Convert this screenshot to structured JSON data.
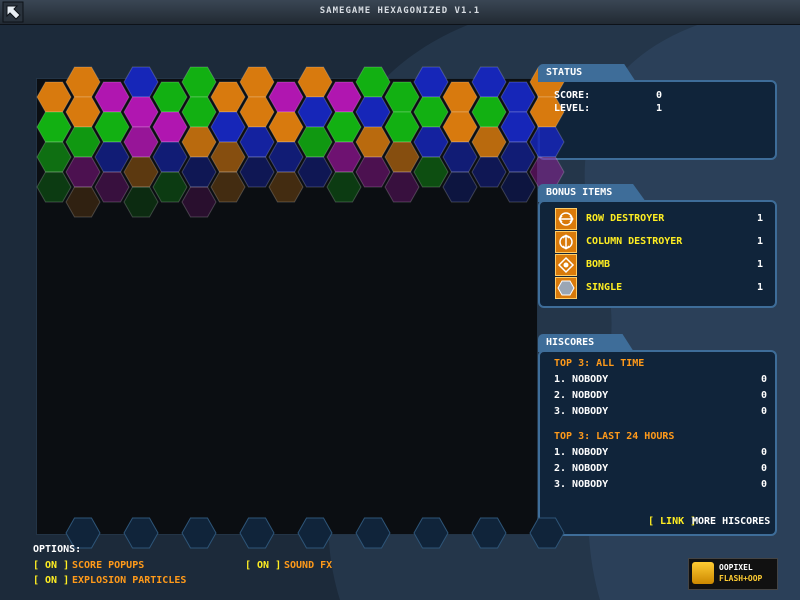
{
  "window": {
    "title": "SAMEGAME HEXAGONIZED V1.1"
  },
  "colors": {
    "orange": "#d87a0e",
    "blue": "#1626b8",
    "magenta": "#b016b0",
    "green": "#12b012",
    "panel_border": "#3e6d99",
    "accent_yellow": "#ffee22",
    "accent_orange": "#ff9a1a"
  },
  "board": {
    "rows": [
      [
        "orange",
        "blue",
        "green",
        "orange",
        "orange",
        "green",
        "blue",
        "blue",
        "orange"
      ],
      [
        "orange",
        "magenta",
        "green",
        "orange",
        "magenta",
        "magenta",
        "green",
        "orange",
        "blue"
      ],
      [
        "orange",
        "magenta",
        "green",
        "orange",
        "blue",
        "blue",
        "green",
        "green",
        "orange"
      ],
      [
        "green",
        "green",
        "magenta",
        "blue",
        "orange",
        "green",
        "green",
        "orange",
        "blue"
      ],
      [
        "green",
        "magenta",
        "orange",
        "blue",
        "green",
        "orange",
        "blue",
        "orange",
        "blue"
      ],
      [
        "green",
        "blue",
        "blue",
        "orange",
        "blue",
        "magenta",
        "orange",
        "blue",
        "blue"
      ],
      [
        "magenta",
        "orange",
        "blue",
        "blue",
        "blue",
        "magenta",
        "green",
        "blue",
        "magenta"
      ],
      [
        "green",
        "magenta",
        "green",
        "orange",
        "orange",
        "green",
        "magenta",
        "blue",
        "blue"
      ],
      [
        "orange",
        "green",
        "magenta",
        "",
        "",
        "",
        "",
        "",
        ""
      ]
    ]
  },
  "status": {
    "tab": "STATUS",
    "score_label": "SCORE:",
    "score_value": "0",
    "level_label": "LEVEL:",
    "level_value": "1"
  },
  "bonus": {
    "tab": "BONUS ITEMS",
    "items": [
      {
        "label": "ROW DESTROYER",
        "count": "1",
        "icon": "row-destroyer-icon"
      },
      {
        "label": "COLUMN DESTROYER",
        "count": "1",
        "icon": "column-destroyer-icon"
      },
      {
        "label": "BOMB",
        "count": "1",
        "icon": "bomb-icon"
      },
      {
        "label": "SINGLE",
        "count": "1",
        "icon": "single-icon"
      }
    ]
  },
  "hiscores": {
    "tab": "HISCORES",
    "all_time_title": "TOP 3: ALL TIME",
    "all_time": [
      {
        "name": "1. NOBODY",
        "score": "0"
      },
      {
        "name": "2. NOBODY",
        "score": "0"
      },
      {
        "name": "3. NOBODY",
        "score": "0"
      }
    ],
    "last24_title": "TOP 3: LAST 24 HOURS",
    "last24": [
      {
        "name": "1. NOBODY",
        "score": "0"
      },
      {
        "name": "2. NOBODY",
        "score": "0"
      },
      {
        "name": "3. NOBODY",
        "score": "0"
      }
    ],
    "link_label": "[ LINK ]",
    "more_label": "MORE HISCORES"
  },
  "options": {
    "title": "OPTIONS:",
    "score_popups": {
      "toggle": "[ ON ]",
      "label": "SCORE POPUPS"
    },
    "sound_fx": {
      "toggle": "[ ON ]",
      "label": "SOUND FX"
    },
    "explosion": {
      "toggle": "[ ON ]",
      "label": "EXPLOSION PARTICLES"
    }
  },
  "logo": {
    "line1": "OOPIXEL",
    "line2": "FLASH+OOP"
  }
}
